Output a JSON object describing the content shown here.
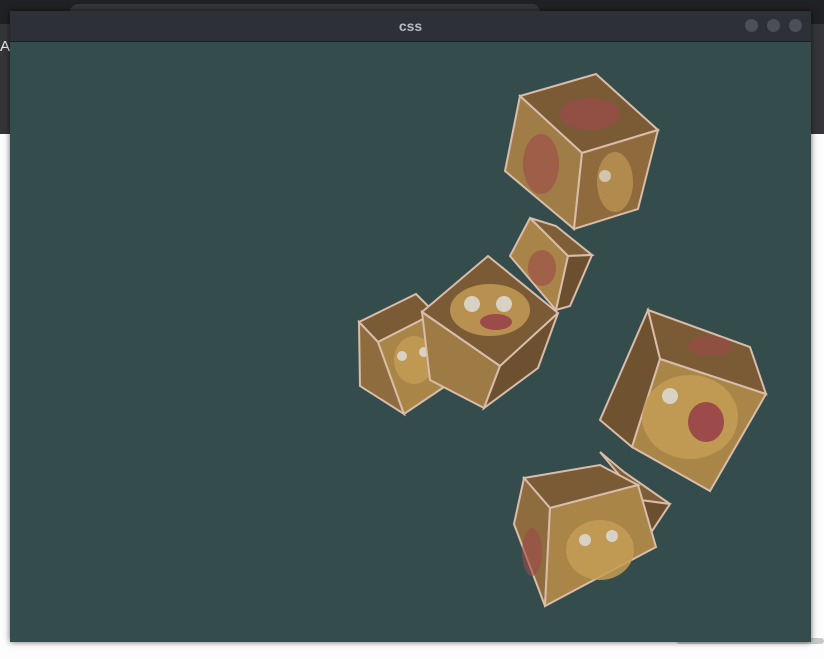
{
  "window": {
    "title": "css",
    "background_color": "#344d4c",
    "controls": [
      {
        "name": "minimize",
        "icon": "circle-icon"
      },
      {
        "name": "maximize",
        "icon": "circle-icon"
      },
      {
        "name": "close",
        "icon": "circle-icon"
      }
    ]
  },
  "background_app": {
    "partial_text": "A"
  },
  "scene": {
    "object": "textured cube",
    "cube_count": 6,
    "face_palette": {
      "light": "#b3894a",
      "mid": "#8d6a3c",
      "dark": "#5e4528",
      "accent": "#9d4a4a",
      "edge": "#d9bcaa"
    }
  }
}
